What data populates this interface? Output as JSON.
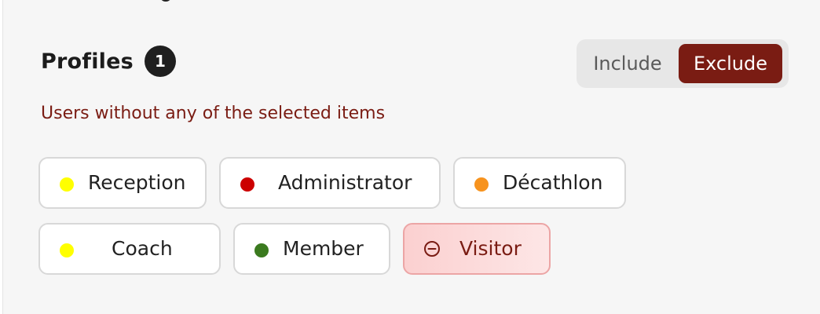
{
  "section": {
    "title": "Profiles",
    "count": "1",
    "description": "Users without any of the selected items"
  },
  "toggle": {
    "include_label": "Include",
    "exclude_label": "Exclude",
    "selected": "Exclude"
  },
  "profiles": [
    {
      "label": "Reception",
      "color": "#ffff00",
      "selected": false
    },
    {
      "label": "Administrator",
      "color": "#cc0000",
      "selected": false
    },
    {
      "label": "Décathlon",
      "color": "#f7931e",
      "selected": false
    },
    {
      "label": "Coach",
      "color": "#ffff00",
      "selected": false
    },
    {
      "label": "Member",
      "color": "#3b7a1f",
      "selected": false
    },
    {
      "label": "Visitor",
      "icon": "minus-circle-icon",
      "selected": true
    }
  ],
  "colors": {
    "accent": "#7a1c13",
    "selected_chip_bg": "#fbd0d0"
  }
}
